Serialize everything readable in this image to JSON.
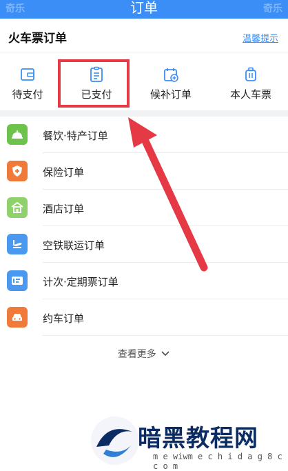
{
  "topbar": {
    "title": "订单",
    "watermark_left": "奇乐",
    "watermark_right": "奇乐"
  },
  "header": {
    "title": "火车票订单",
    "tip_link": "温馨提示"
  },
  "quick_tabs": [
    {
      "label": "待支付",
      "icon": "wallet-icon"
    },
    {
      "label": "已支付",
      "icon": "receipt-icon"
    },
    {
      "label": "候补订单",
      "icon": "calendar-add-icon"
    },
    {
      "label": "本人车票",
      "icon": "luggage-icon"
    }
  ],
  "list": [
    {
      "label": "餐饮·特产订单",
      "icon": "dining-bell-icon",
      "color": "#6cc24a"
    },
    {
      "label": "保险订单",
      "icon": "shield-icon",
      "color": "#f07a3a"
    },
    {
      "label": "酒店订单",
      "icon": "hotel-icon",
      "color": "#8fd16a"
    },
    {
      "label": "空铁联运订单",
      "icon": "plane-train-icon",
      "color": "#4a98f0"
    },
    {
      "label": "计次·定期票订单",
      "icon": "ticket-icon",
      "color": "#4a98f0"
    },
    {
      "label": "约车订单",
      "icon": "car-icon",
      "color": "#f07a3a"
    }
  ],
  "more": {
    "label": "查看更多",
    "chevron": "chevron-down-icon"
  },
  "annotation": {
    "highlight_color": "#e53a46"
  },
  "footer_watermark": {
    "title": "暗黑教程网",
    "url": "m e wiwm e c h i d a g 8 c c o m"
  },
  "colors": {
    "accent": "#3a8ef6",
    "divider": "#f1f2f4"
  }
}
